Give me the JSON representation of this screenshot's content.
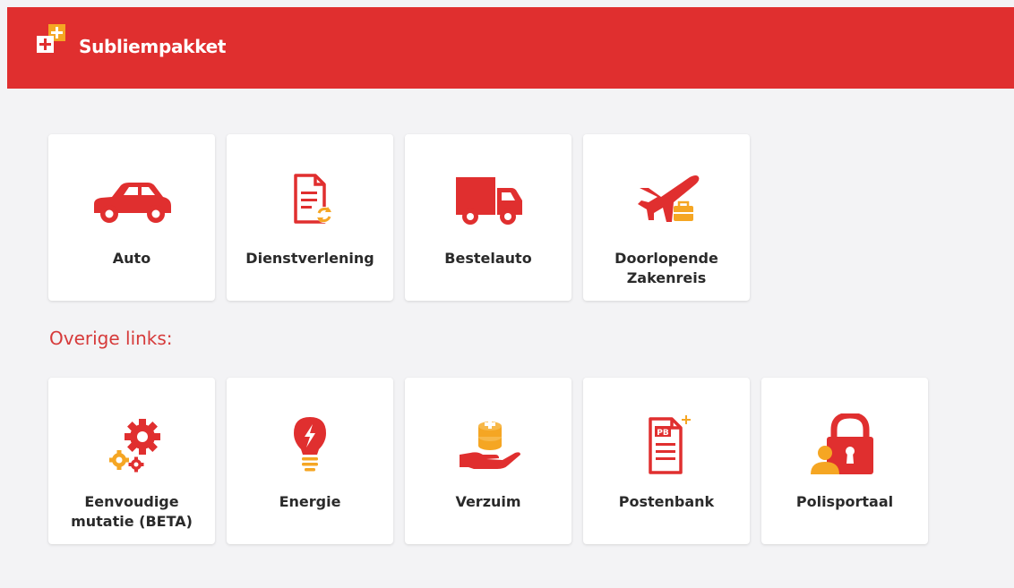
{
  "header": {
    "title": "Subliempakket",
    "brand_color": "#e02f2f"
  },
  "main_tiles": [
    {
      "label": "Auto",
      "icon": "car-icon"
    },
    {
      "label": "Dienstverlening",
      "icon": "document-refresh-icon"
    },
    {
      "label": "Bestelauto",
      "icon": "van-icon"
    },
    {
      "label": "Doorlopende Zakenreis",
      "icon": "airplane-briefcase-icon"
    }
  ],
  "other_links": {
    "title": "Overige links:",
    "tiles": [
      {
        "label": "Eenvoudige mutatie (BETA)",
        "icon": "gears-icon"
      },
      {
        "label": "Energie",
        "icon": "lightbulb-icon"
      },
      {
        "label": "Verzuim",
        "icon": "hand-coins-icon"
      },
      {
        "label": "Postenbank",
        "icon": "pb-document-icon"
      },
      {
        "label": "Polisportaal",
        "icon": "lock-user-icon"
      }
    ]
  },
  "colors": {
    "accent_red": "#e02f2f",
    "accent_orange": "#f5a623",
    "background": "#f3f3f5"
  }
}
